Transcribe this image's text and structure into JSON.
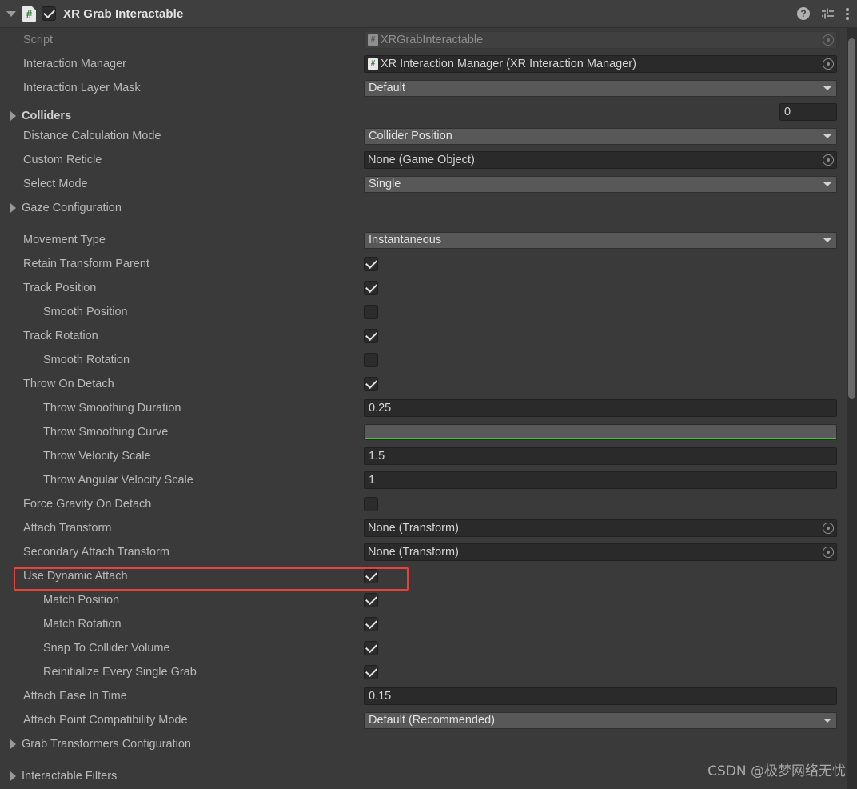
{
  "header": {
    "title": "XR Grab Interactable",
    "enabled": true,
    "expanded": true,
    "script_icon": "#",
    "icons": {
      "help": "help-icon",
      "preset": "preset-icon",
      "menu": "kebab-menu-icon"
    },
    "help_glyph": "?"
  },
  "colors": {
    "background": "#3a3a3a",
    "header_bg": "#3f3f3f",
    "field_bg": "#2a2a2a",
    "dropdown_bg": "#585858",
    "highlight": "#e8413a",
    "curve_green": "#3fc43f",
    "script_green": "#2d7a2d"
  },
  "rows": [
    {
      "kind": "object",
      "label": "Script",
      "value": "XRGrabInteractable",
      "disabled": true,
      "icon": "#"
    },
    {
      "kind": "object",
      "label": "Interaction Manager",
      "value": "XR Interaction Manager (XR Interaction Manager)",
      "disabled": false,
      "icon": "#"
    },
    {
      "kind": "dropdown",
      "label": "Interaction Layer Mask",
      "value": "Default"
    },
    {
      "kind": "size",
      "label": "",
      "value": "0"
    },
    {
      "kind": "dropdown",
      "label": "Distance Calculation Mode",
      "value": "Collider Position"
    },
    {
      "kind": "object",
      "label": "Custom Reticle",
      "value": "None (Game Object)",
      "disabled": false
    },
    {
      "kind": "dropdown",
      "label": "Select Mode",
      "value": "Single"
    },
    {
      "kind": "dropdown",
      "label": "Movement Type",
      "value": "Instantaneous"
    },
    {
      "kind": "toggle",
      "label": "Retain Transform Parent",
      "checked": true
    },
    {
      "kind": "toggle",
      "label": "Track Position",
      "checked": true
    },
    {
      "kind": "toggle",
      "label": "Smooth Position",
      "checked": false,
      "indent": 1
    },
    {
      "kind": "toggle",
      "label": "Track Rotation",
      "checked": true
    },
    {
      "kind": "toggle",
      "label": "Smooth Rotation",
      "checked": false,
      "indent": 1
    },
    {
      "kind": "toggle",
      "label": "Throw On Detach",
      "checked": true
    },
    {
      "kind": "number",
      "label": "Throw Smoothing Duration",
      "value": "0.25",
      "indent": 1
    },
    {
      "kind": "curve",
      "label": "Throw Smoothing Curve",
      "indent": 1
    },
    {
      "kind": "number",
      "label": "Throw Velocity Scale",
      "value": "1.5",
      "indent": 1
    },
    {
      "kind": "number",
      "label": "Throw Angular Velocity Scale",
      "value": "1",
      "indent": 1
    },
    {
      "kind": "toggle",
      "label": "Force Gravity On Detach",
      "checked": false
    },
    {
      "kind": "object",
      "label": "Attach Transform",
      "value": "None (Transform)"
    },
    {
      "kind": "object",
      "label": "Secondary Attach Transform",
      "value": "None (Transform)"
    },
    {
      "kind": "toggle",
      "label": "Use Dynamic Attach",
      "checked": true,
      "highlighted": true
    },
    {
      "kind": "toggle",
      "label": "Match Position",
      "checked": true,
      "indent": 1
    },
    {
      "kind": "toggle",
      "label": "Match Rotation",
      "checked": true,
      "indent": 1
    },
    {
      "kind": "toggle",
      "label": "Snap To Collider Volume",
      "checked": true,
      "indent": 1
    },
    {
      "kind": "toggle",
      "label": "Reinitialize Every Single Grab",
      "checked": true,
      "indent": 1
    },
    {
      "kind": "number",
      "label": "Attach Ease In Time",
      "value": "0.15"
    },
    {
      "kind": "dropdown",
      "label": "Attach Point Compatibility Mode",
      "value": "Default (Recommended)"
    }
  ],
  "foldouts": {
    "colliders": "Colliders",
    "gaze_configuration": "Gaze Configuration",
    "grab_transformers_configuration": "Grab Transformers Configuration",
    "interactable_filters": "Interactable Filters"
  },
  "labels": {
    "script": "Script",
    "interaction_manager": "Interaction Manager",
    "interaction_layer_mask": "Interaction Layer Mask",
    "distance_calculation_mode": "Distance Calculation Mode",
    "custom_reticle": "Custom Reticle",
    "select_mode": "Select Mode",
    "movement_type": "Movement Type",
    "retain_transform_parent": "Retain Transform Parent",
    "track_position": "Track Position",
    "smooth_position": "Smooth Position",
    "track_rotation": "Track Rotation",
    "smooth_rotation": "Smooth Rotation",
    "throw_on_detach": "Throw On Detach",
    "throw_smoothing_duration": "Throw Smoothing Duration",
    "throw_smoothing_curve": "Throw Smoothing Curve",
    "throw_velocity_scale": "Throw Velocity Scale",
    "throw_angular_velocity_scale": "Throw Angular Velocity Scale",
    "force_gravity_on_detach": "Force Gravity On Detach",
    "attach_transform": "Attach Transform",
    "secondary_attach_transform": "Secondary Attach Transform",
    "use_dynamic_attach": "Use Dynamic Attach",
    "match_position": "Match Position",
    "match_rotation": "Match Rotation",
    "snap_to_collider_volume": "Snap To Collider Volume",
    "reinitialize_every_single_grab": "Reinitialize Every Single Grab",
    "attach_ease_in_time": "Attach Ease In Time",
    "attach_point_compatibility_mode": "Attach Point Compatibility Mode"
  },
  "values": {
    "script": "XRGrabInteractable",
    "interaction_manager": "XR Interaction Manager (XR Interaction Manager)",
    "interaction_layer_mask": "Default",
    "colliders_size": "0",
    "distance_calculation_mode": "Collider Position",
    "custom_reticle": "None (Game Object)",
    "select_mode": "Single",
    "movement_type": "Instantaneous",
    "throw_smoothing_duration": "0.25",
    "throw_velocity_scale": "1.5",
    "throw_angular_velocity_scale": "1",
    "attach_transform": "None (Transform)",
    "secondary_attach_transform": "None (Transform)",
    "attach_ease_in_time": "0.15",
    "attach_point_compatibility_mode": "Default (Recommended)"
  },
  "watermark": "CSDN @极梦网络无忧"
}
